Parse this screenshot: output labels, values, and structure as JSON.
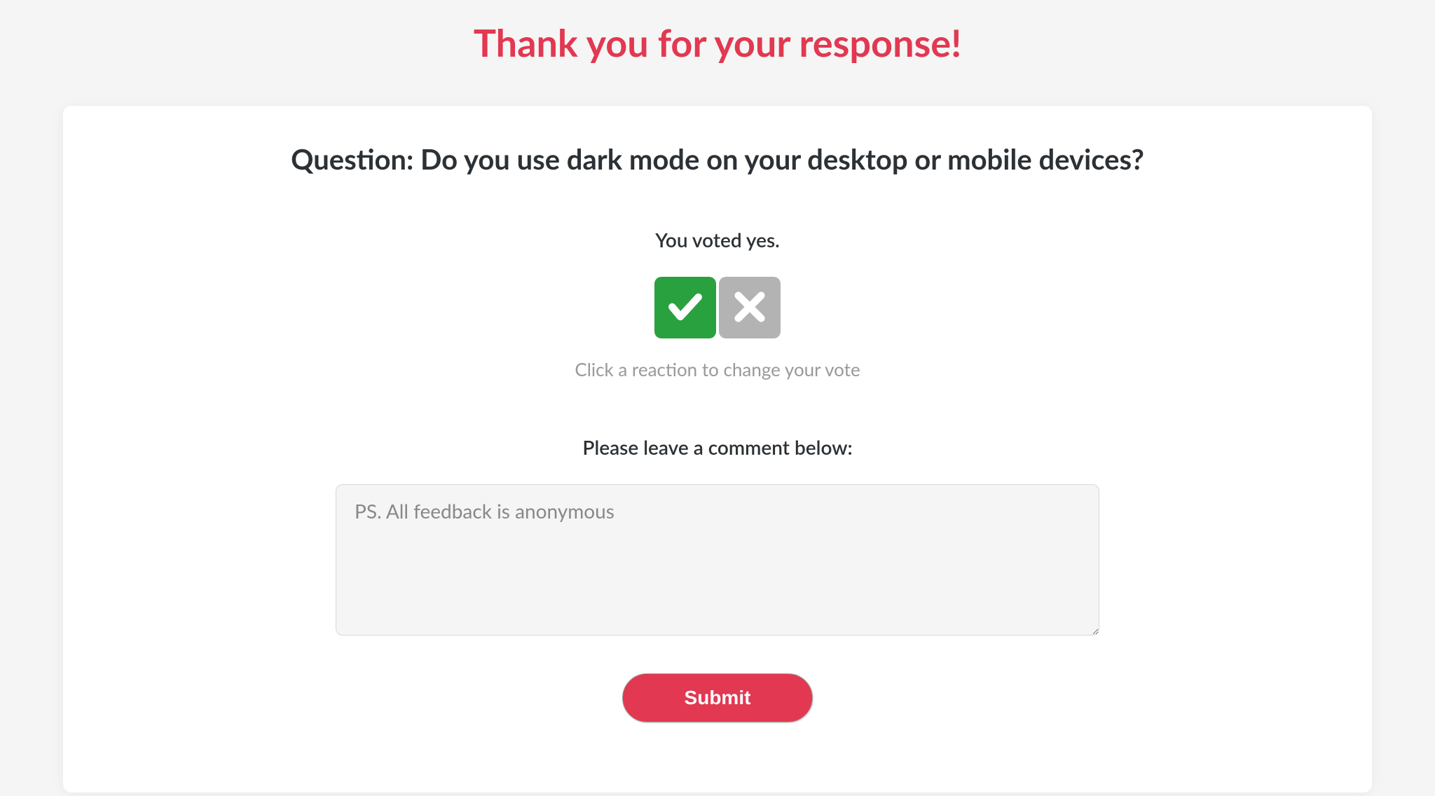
{
  "header": {
    "title": "Thank you for your response!"
  },
  "card": {
    "question": "Question: Do you use dark mode on your desktop or mobile devices?",
    "vote_status": "You voted yes.",
    "vote_hint": "Click a reaction to change your vote",
    "comment_label": "Please leave a comment below:",
    "comment_placeholder": "PS. All feedback is anonymous",
    "submit_label": "Submit"
  },
  "icons": {
    "check": "check-icon",
    "cross": "cross-icon"
  },
  "colors": {
    "accent": "#e23851",
    "yes": "#2aa13f",
    "no": "#b3b3b3"
  }
}
